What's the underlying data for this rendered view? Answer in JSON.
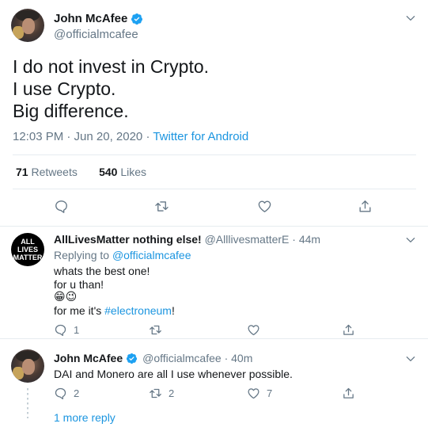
{
  "main_tweet": {
    "author_name": "John McAfee",
    "author_handle": "@officialmcafee",
    "lines": [
      "I do not invest in Crypto.",
      "I use Crypto.",
      "Big difference."
    ],
    "timestamp": "12:03 PM · Jun 20, 2020 · ",
    "source": "Twitter for Android",
    "retweets_count": "71",
    "retweets_label": "Retweets",
    "likes_count": "540",
    "likes_label": "Likes"
  },
  "reply1": {
    "author_name": "AllLivesMatter nothing else!",
    "author_handle_time": "@AlllivesmatterE · 44m",
    "avatar_text": "ALL LIVES MATTER",
    "replying_to_prefix": "Replying to ",
    "replying_to_handle": "@officialmcafee",
    "line1": "whats the best one!",
    "line2": "for u than!",
    "emojis": "😁😉",
    "line4_prefix": "for me it's ",
    "line4_hashtag": "#electroneum",
    "line4_suffix": "!",
    "reply_count": "1"
  },
  "reply2": {
    "author_name": "John McAfee",
    "author_handle_time": "@officialmcafee · 40m",
    "text": "DAI and Monero are all I use whenever possible.",
    "reply_count": "2",
    "retweet_count": "2",
    "like_count": "7"
  },
  "more_replies": "1 more reply",
  "colors": {
    "accent": "#1b95e0",
    "muted": "#657786",
    "border": "#e6ecf0"
  }
}
